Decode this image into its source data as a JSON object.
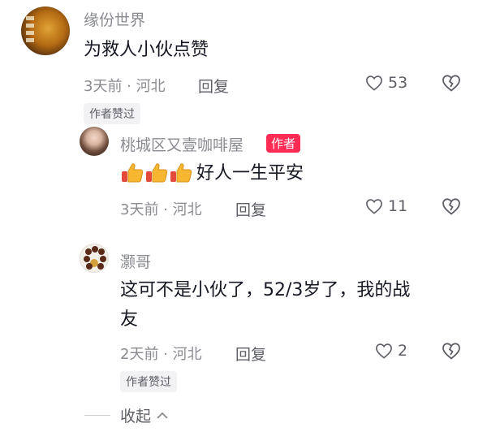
{
  "comments": [
    {
      "name": "缘份世界",
      "text": "为救人小伙点赞",
      "time": "3天前 · 河北",
      "reply": "回复",
      "likes": "53",
      "badge": "作者赞过"
    },
    {
      "name": "桃城区又壹咖啡屋",
      "author_tag": "作者",
      "text": "好人一生平安",
      "time": "3天前 · 河北",
      "reply": "回复",
      "likes": "11"
    },
    {
      "name": "灏哥",
      "text_line1": "这可不是小伙了，52/3岁了，我的战",
      "text_line2": "友",
      "time": "2天前 · 河北",
      "reply": "回复",
      "likes": "2",
      "badge": "作者赞过"
    }
  ],
  "collapse": {
    "label": "收起"
  },
  "icons": {
    "like": "heart-outline-icon",
    "dislike": "broken-heart-icon",
    "thumbs": "thumbs-up-emoji",
    "collapse": "chevron-up-icon"
  },
  "colors": {
    "author_tag": "#fe2c55",
    "muted": "#8a8b91",
    "text": "#161823"
  }
}
